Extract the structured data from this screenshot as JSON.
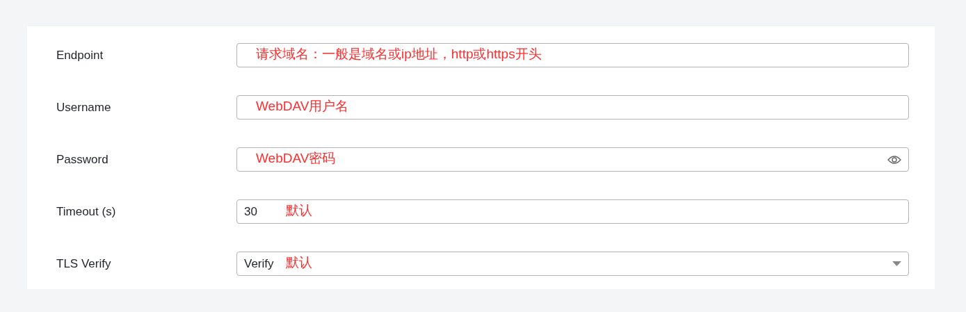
{
  "fields": [
    {
      "kind": "text",
      "label": "Endpoint",
      "note": "请求域名：一般是域名或ip地址，http或https开头"
    },
    {
      "kind": "text",
      "label": "Username",
      "note": "WebDAV用户名"
    },
    {
      "kind": "password",
      "label": "Password",
      "note": "WebDAV密码"
    },
    {
      "kind": "number",
      "label": "Timeout (s)",
      "value": "30",
      "note": "默认"
    },
    {
      "kind": "select",
      "label": "TLS Verify",
      "value": "Verify",
      "note": "默认"
    }
  ]
}
